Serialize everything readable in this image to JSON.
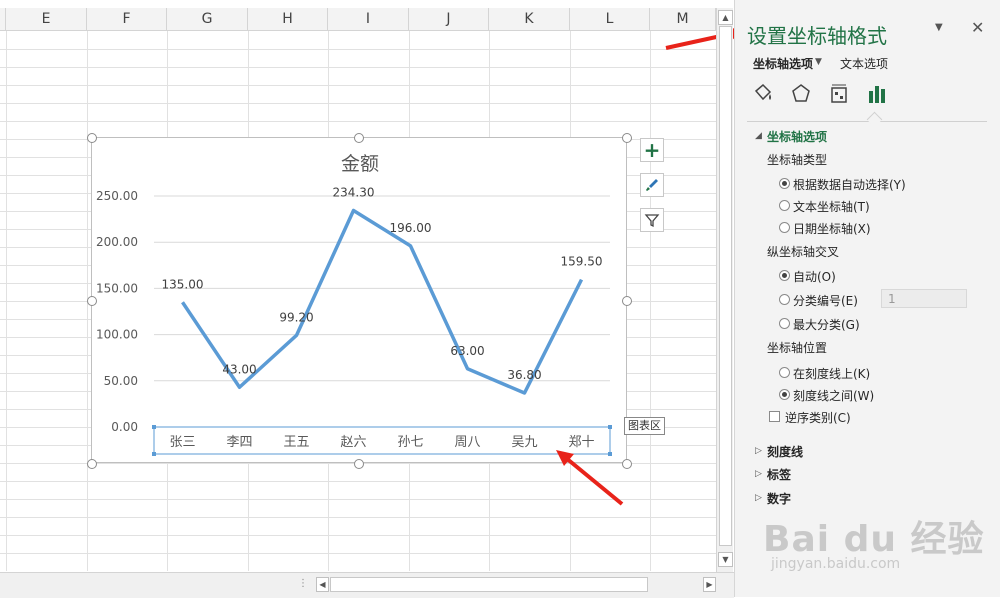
{
  "columns": [
    "E",
    "F",
    "G",
    "H",
    "I",
    "J",
    "K",
    "L",
    "M"
  ],
  "chart_data": {
    "type": "line",
    "title": "金额",
    "categories": [
      "张三",
      "李四",
      "王五",
      "赵六",
      "孙七",
      "周八",
      "吴九",
      "郑十"
    ],
    "values": [
      135.0,
      43.0,
      99.2,
      234.3,
      196.0,
      63.0,
      36.8,
      159.5
    ],
    "data_labels": [
      "135.00",
      "43.00",
      "99.20",
      "234.30",
      "196.00",
      "63.00",
      "36.80",
      "159.50"
    ],
    "yticks": [
      "0.00",
      "50.00",
      "100.00",
      "150.00",
      "200.00",
      "250.00"
    ],
    "ylim": [
      0,
      250
    ],
    "grid": true,
    "series_color": "#5b9bd5"
  },
  "tooltip": "图表区",
  "panel": {
    "title": "设置坐标轴格式",
    "tab_axis_options": "坐标轴选项",
    "tab_text_options": "文本选项",
    "section_axis_options": "坐标轴选项",
    "axis_type_heading": "坐标轴类型",
    "axis_type_options": [
      "根据数据自动选择(Y)",
      "文本坐标轴(T)",
      "日期坐标轴(X)"
    ],
    "crosses_heading": "纵坐标轴交叉",
    "crosses_options": [
      "自动(O)",
      "分类编号(E)",
      "最大分类(G)"
    ],
    "crosses_value": "1",
    "position_heading": "坐标轴位置",
    "position_options": [
      "在刻度线上(K)",
      "刻度线之间(W)"
    ],
    "reverse_label": "逆序类别(C)",
    "collapsed_sections": [
      "刻度线",
      "标签",
      "数字"
    ],
    "accent_color": "#217346"
  },
  "watermark": {
    "main": "Bai du 经验",
    "sub": "jingyan.baidu.com"
  }
}
